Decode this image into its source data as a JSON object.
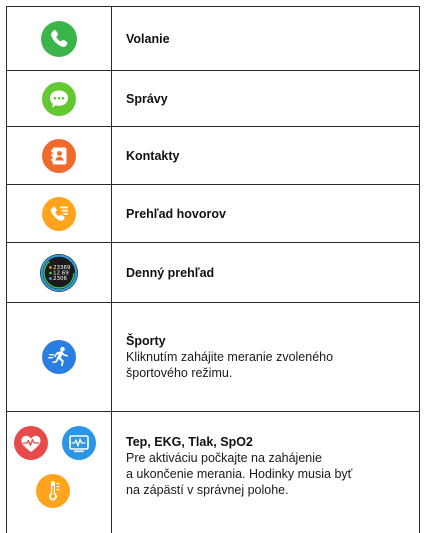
{
  "rows": [
    {
      "title": "Volanie",
      "icon": "phone-icon",
      "color": "#3bb54a"
    },
    {
      "title": "Správy",
      "icon": "message-icon",
      "color": "#63c832"
    },
    {
      "title": "Kontakty",
      "icon": "contacts-icon",
      "color": "#f06a2b"
    },
    {
      "title": "Prehľad hovorov",
      "icon": "call-log-icon",
      "color": "#ffa41c"
    },
    {
      "title": "Denný prehľad",
      "icon": "daily-overview-icon",
      "color": "#1b1b1b",
      "stats": [
        "23369",
        "12.69",
        "2306"
      ]
    },
    {
      "title": "Športy",
      "icon": "sports-icon",
      "color": "#2a7de1",
      "description_lines": [
        "Kliknutím zahájite meranie zvoleného",
        "športového režimu."
      ]
    },
    {
      "title": "Tep, EKG, Tlak, SpO2",
      "icon": "health-icons",
      "colors": [
        "#e84a4a",
        "#2b95e6",
        "#ffa41c"
      ],
      "description_lines": [
        "Pre aktiváciu počkajte na zahájenie",
        "a ukončenie merania. Hodinky musia byť",
        "na zápästí v správnej polohe."
      ]
    }
  ]
}
